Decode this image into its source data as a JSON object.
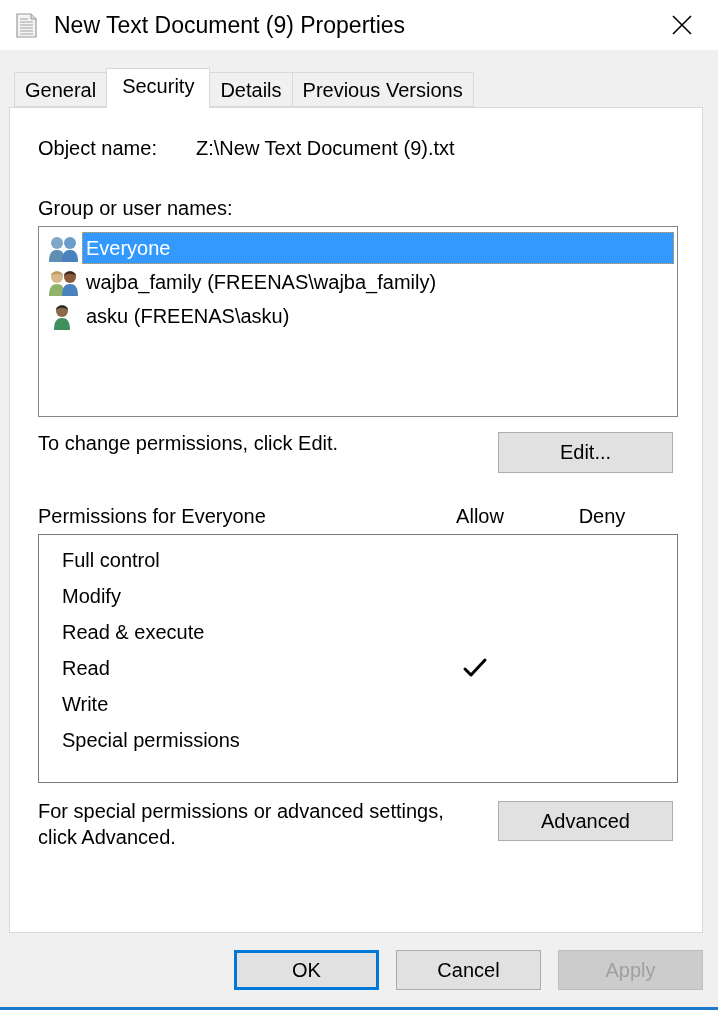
{
  "window": {
    "title": "New Text Document (9) Properties"
  },
  "tabs": [
    {
      "label": "General",
      "selected": false
    },
    {
      "label": "Security",
      "selected": true
    },
    {
      "label": "Details",
      "selected": false
    },
    {
      "label": "Previous Versions",
      "selected": false
    }
  ],
  "object_name": {
    "label": "Object name:",
    "value": "Z:\\New Text Document (9).txt"
  },
  "principals": {
    "label": "Group or user names:",
    "items": [
      {
        "name": "Everyone",
        "kind": "group",
        "selected": true
      },
      {
        "name": "wajba_family (FREENAS\\wajba_family)",
        "kind": "family",
        "selected": false
      },
      {
        "name": "asku (FREENAS\\asku)",
        "kind": "user",
        "selected": false
      }
    ]
  },
  "edit": {
    "hint": "To change permissions, click Edit.",
    "button": "Edit..."
  },
  "permissions": {
    "title": "Permissions for Everyone",
    "allow_header": "Allow",
    "deny_header": "Deny",
    "rows": [
      {
        "name": "Full control",
        "allow": false,
        "deny": false
      },
      {
        "name": "Modify",
        "allow": false,
        "deny": false
      },
      {
        "name": "Read & execute",
        "allow": false,
        "deny": false
      },
      {
        "name": "Read",
        "allow": true,
        "deny": false
      },
      {
        "name": "Write",
        "allow": false,
        "deny": false
      },
      {
        "name": "Special permissions",
        "allow": false,
        "deny": false
      }
    ]
  },
  "advanced": {
    "hint": "For special permissions or advanced settings, click Advanced.",
    "button": "Advanced"
  },
  "buttons": [
    {
      "label": "OK",
      "default": true,
      "disabled": false
    },
    {
      "label": "Cancel",
      "default": false,
      "disabled": false
    },
    {
      "label": "Apply",
      "default": false,
      "disabled": true
    }
  ]
}
